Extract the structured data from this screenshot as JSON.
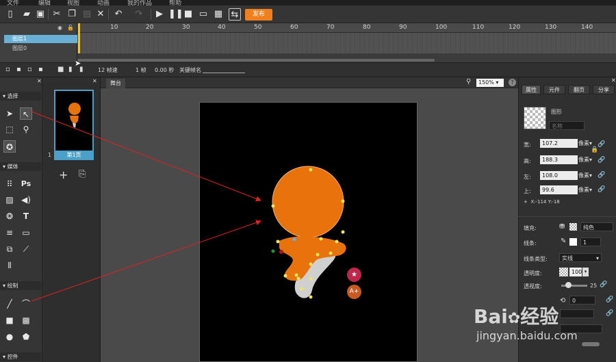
{
  "menu": [
    "文件",
    "编辑",
    "视图",
    "动画",
    "我的作品",
    "帮助"
  ],
  "toolbar": {
    "publish_label": "发布"
  },
  "timeline": {
    "ruler_ticks": [
      "10",
      "20",
      "30",
      "40",
      "50",
      "60",
      "70",
      "80",
      "90",
      "100",
      "110",
      "120",
      "130",
      "140"
    ],
    "layers": [
      "图层1",
      "图层0"
    ],
    "fps": "12 帧速",
    "frame": "1 帧",
    "time": "0.00 秒",
    "keyframe_label": "关键帧名"
  },
  "tools": {
    "section_select": "选择",
    "section_media": "媒体",
    "section_draw": "绘制",
    "section_controls": "控件",
    "ps_label": "Ps"
  },
  "pages": {
    "thumb_label": "第1页",
    "page_number": "1"
  },
  "stage": {
    "tab": "舞台",
    "zoom": "150%"
  },
  "right_panel": {
    "tabs": [
      "属性",
      "元件",
      "翻页",
      "分享"
    ],
    "object_type": "图形",
    "name_placeholder": "名称",
    "width_label": "宽:",
    "width_value": "107.2",
    "height_label": "高:",
    "height_value": "188.3",
    "left_label": "左:",
    "left_value": "108.0",
    "top_label": "上:",
    "top_value": "99.6",
    "unit": "像素",
    "coords": "X:-114   Y:-18",
    "fill_label": "填充:",
    "fill_value": "纯色",
    "stroke_label": "线条:",
    "stroke_value": "1",
    "stroke_type_label": "线条类型:",
    "stroke_type_value": "实线",
    "opacity_label": "透明度:",
    "opacity_value": "100",
    "blur_label": "透视度:",
    "blur_value": "25",
    "rotate_value": "0"
  },
  "watermark": {
    "brand": "Bai",
    "brand_cn": "经验",
    "url": "jingyan.baidu.com"
  },
  "colors": {
    "accent": "#f07f1e",
    "selection": "#4aa0c8",
    "shape": "#e8720c",
    "arrow": "#e02020"
  }
}
